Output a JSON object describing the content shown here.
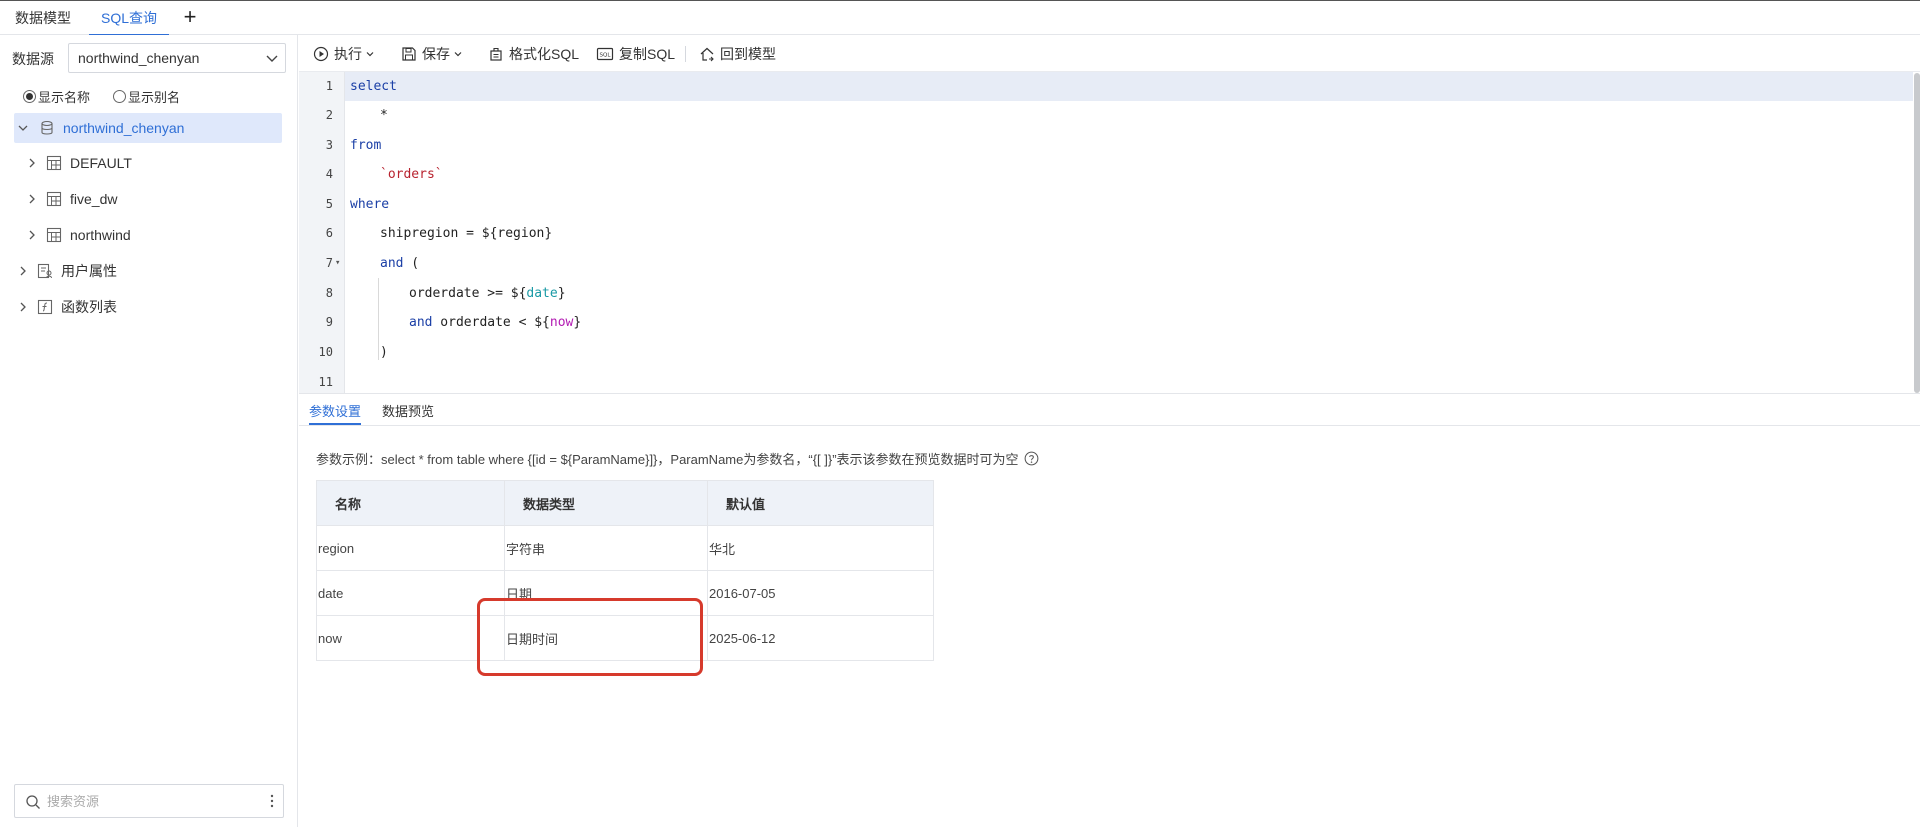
{
  "top_tabs": [
    {
      "label": "数据模型",
      "active": false
    },
    {
      "label": "SQL查询",
      "active": true
    }
  ],
  "sidebar": {
    "datasource_label": "数据源",
    "datasource_value": "northwind_chenyan",
    "radio_show_name": "显示名称",
    "radio_show_alias": "显示别名",
    "tree": {
      "root": "northwind_chenyan",
      "children": [
        "DEFAULT",
        "five_dw",
        "northwind"
      ],
      "user_attrs": "用户属性",
      "functions": "函数列表"
    },
    "search_placeholder": "搜索资源"
  },
  "toolbar": {
    "run": "执行",
    "save": "保存",
    "format": "格式化SQL",
    "copy": "复制SQL",
    "back": "回到模型"
  },
  "editor": {
    "line_numbers": [
      "1",
      "2",
      "3",
      "4",
      "5",
      "6",
      "7",
      "8",
      "9",
      "10",
      "11"
    ],
    "lines": {
      "l1": "select",
      "l2": "*",
      "l3": "from",
      "l4": "`orders`",
      "l5": "where",
      "l6": "shipregion = ${region}",
      "l7_kw": "and",
      "l7_rest": " (",
      "l8_a": "orderdate >= ${",
      "l8_var": "date",
      "l8_b": "}",
      "l9_kw": "and",
      "l9_a": " orderdate < ${",
      "l9_var": "now",
      "l9_b": "}",
      "l10": ")"
    }
  },
  "bottom_tabs": [
    "参数设置",
    "数据预览"
  ],
  "hint": "参数示例：select * from table where {[id = ${ParamName}]}，ParamName为参数名，“{[ ]}”表示该参数在预览数据时可为空",
  "param_table": {
    "headers": [
      "名称",
      "数据类型",
      "默认值"
    ],
    "rows": [
      [
        "region",
        "字符串",
        "华北"
      ],
      [
        "date",
        "日期",
        "2016-07-05"
      ],
      [
        "now",
        "日期时间",
        "2025-06-12"
      ]
    ]
  },
  "colors": {
    "accent": "#2f6fd6",
    "highlight_box": "#d63a2c",
    "keyword": "#1b3fa6",
    "string": "#b8232f"
  }
}
